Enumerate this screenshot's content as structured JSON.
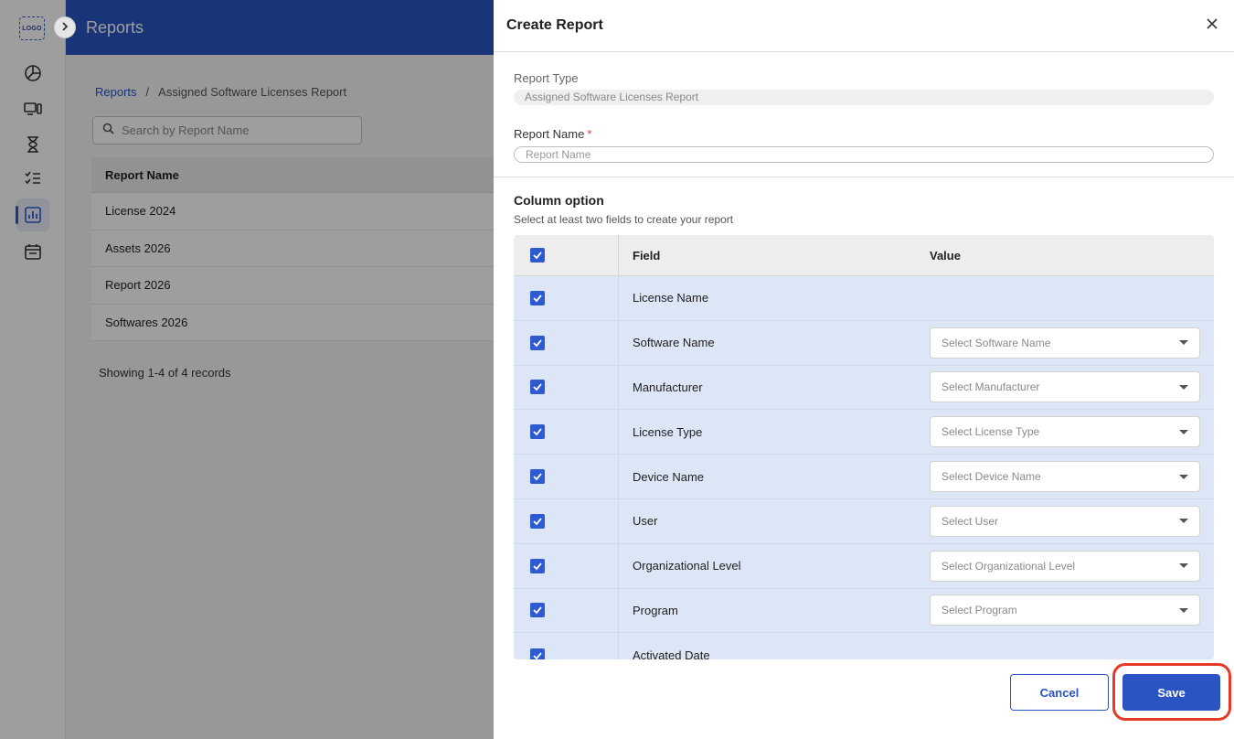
{
  "sidebar": {
    "logo_text": "LOGO",
    "items": [
      {
        "icon": "pie-chart-icon"
      },
      {
        "icon": "devices-icon"
      },
      {
        "icon": "hourglass-icon"
      },
      {
        "icon": "checklist-icon"
      },
      {
        "icon": "reports-chart-icon",
        "active": true
      },
      {
        "icon": "calendar-icon"
      }
    ]
  },
  "header": {
    "title": "Reports"
  },
  "breadcrumb": {
    "root": "Reports",
    "separator": "/",
    "current": "Assigned Software Licenses Report"
  },
  "search": {
    "placeholder": "Search by Report Name"
  },
  "reports_table": {
    "header": "Report Name",
    "rows": [
      "License 2024",
      "Assets 2026",
      "Report 2026",
      "Softwares 2026"
    ],
    "footer": "Showing 1-4 of 4 records"
  },
  "drawer": {
    "title": "Create Report",
    "report_type_label": "Report Type",
    "report_type_value": "Assigned Software Licenses Report",
    "report_name_label": "Report Name",
    "required_mark": "*",
    "report_name_placeholder": "Report Name",
    "column_option_title": "Column option",
    "column_option_subtitle": "Select at least two fields to create your report",
    "columns": {
      "field": "Field",
      "value": "Value"
    },
    "rows": [
      {
        "field": "License Name",
        "select": ""
      },
      {
        "field": "Software Name",
        "select": "Select Software Name"
      },
      {
        "field": "Manufacturer",
        "select": "Select Manufacturer"
      },
      {
        "field": "License Type",
        "select": "Select License Type"
      },
      {
        "field": "Device Name",
        "select": "Select Device Name"
      },
      {
        "field": "User",
        "select": "Select User"
      },
      {
        "field": "Organizational Level",
        "select": "Select Organizational Level"
      },
      {
        "field": "Program",
        "select": "Select Program"
      },
      {
        "field": "Activated Date",
        "select": ""
      }
    ],
    "cancel_label": "Cancel",
    "save_label": "Save"
  },
  "colors": {
    "primary": "#2a54c2",
    "highlight": "#e53a27",
    "row_bg": "#dde6f6"
  }
}
